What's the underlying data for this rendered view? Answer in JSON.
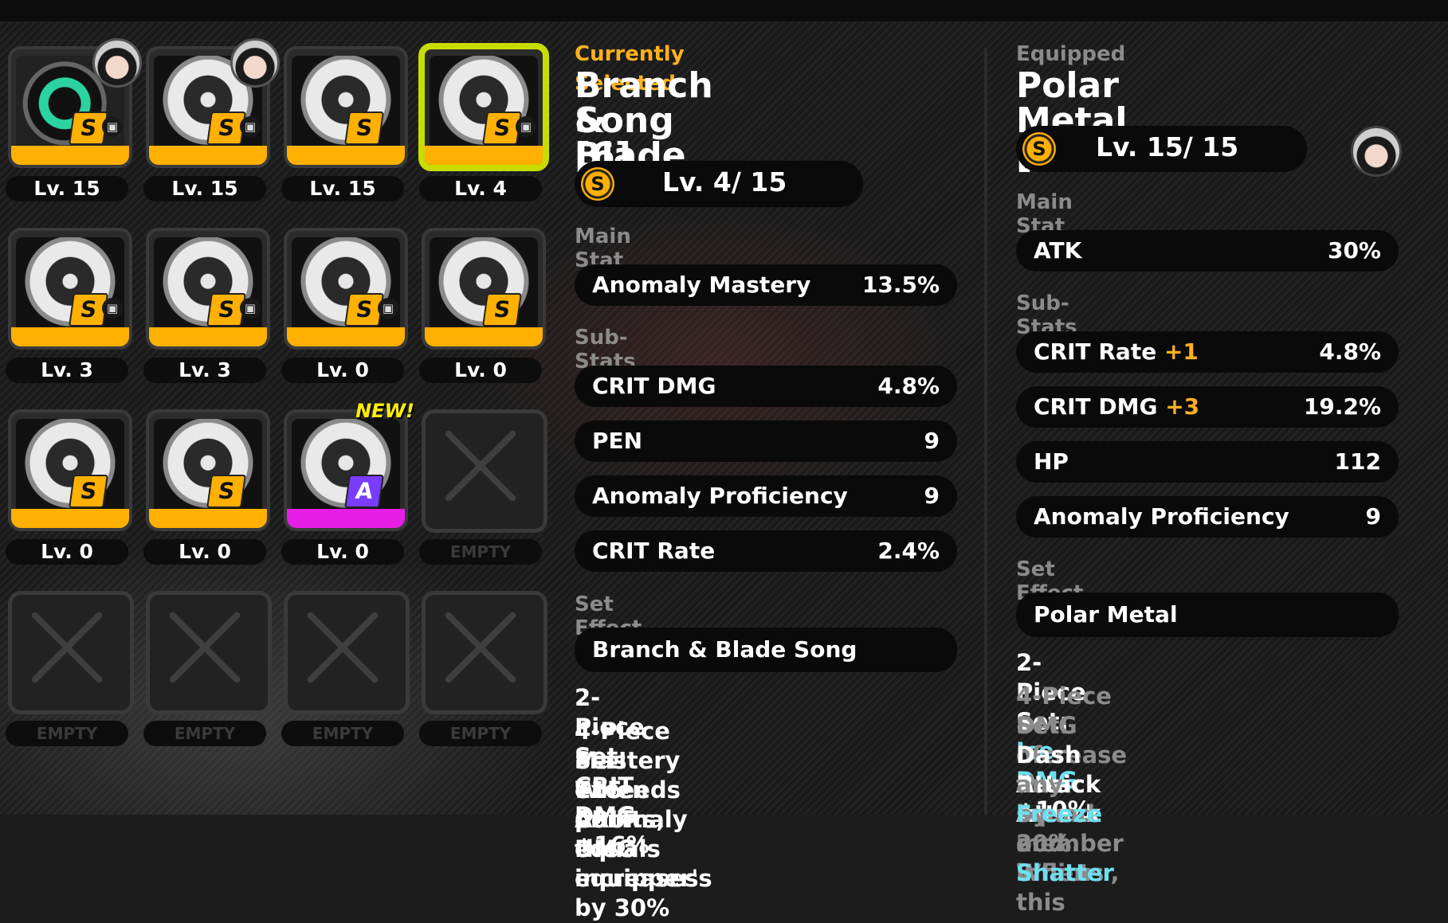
{
  "slots": [
    {
      "level": "Lv. 15",
      "rank": "S",
      "locked": true,
      "avatar": true,
      "variant": "green"
    },
    {
      "level": "Lv. 15",
      "rank": "S",
      "locked": true,
      "avatar": true
    },
    {
      "level": "Lv. 15",
      "rank": "S",
      "locked": false
    },
    {
      "level": "Lv. 4",
      "rank": "S",
      "locked": true,
      "selected": true
    },
    {
      "level": "Lv. 3",
      "rank": "S",
      "locked": true
    },
    {
      "level": "Lv. 3",
      "rank": "S",
      "locked": true
    },
    {
      "level": "Lv. 0",
      "rank": "S",
      "locked": true
    },
    {
      "level": "Lv. 0",
      "rank": "S",
      "locked": false
    },
    {
      "level": "Lv. 0",
      "rank": "S",
      "locked": false
    },
    {
      "level": "Lv. 0",
      "rank": "S",
      "locked": false
    },
    {
      "level": "Lv. 0",
      "rank": "A",
      "locked": false,
      "new": true
    },
    {
      "empty_label": "EMPTY"
    },
    {
      "empty_label": "EMPTY"
    },
    {
      "empty_label": "EMPTY"
    },
    {
      "empty_label": "EMPTY"
    },
    {
      "empty_label": "EMPTY"
    }
  ],
  "new_badge": "NEW!",
  "selected": {
    "header": "Currently Selected",
    "name_line1": "Branch & Blade",
    "name_line2": "Song [6]",
    "rank": "S",
    "level": "Lv. 4/ 15",
    "main_stat_label": "Main Stat",
    "main_stat": {
      "name": "Anomaly Mastery",
      "value": "13.5%"
    },
    "sub_stats_label": "Sub-Stats",
    "sub_stats": [
      {
        "name": "CRIT DMG",
        "value": "4.8%"
      },
      {
        "name": "PEN",
        "value": "9"
      },
      {
        "name": "Anomaly Proficiency",
        "value": "9"
      },
      {
        "name": "CRIT Rate",
        "value": "2.4%"
      }
    ],
    "set_effect_label": "Set Effect",
    "set_name": "Branch & Blade Song",
    "two_piece": "2-Piece Set: CRIT DMG +16%",
    "four_piece_l1": "4-Piece Set: When Anomaly",
    "four_piece_l2": "Mastery exceeds or equals",
    "four_piece_l3": "115 points, the equipper's",
    "four_piece_l4": "CRIT DMG increases by 30%"
  },
  "equipped": {
    "header": "Equipped",
    "name": "Polar Metal [6]",
    "rank": "S",
    "level": "Lv. 15/ 15",
    "main_stat_label": "Main Stat",
    "main_stat": {
      "name": "ATK",
      "value": "30%"
    },
    "sub_stats_label": "Sub-Stats",
    "sub_stats": [
      {
        "name": "CRIT Rate",
        "bonus": "+1",
        "value": "4.8%"
      },
      {
        "name": "CRIT DMG",
        "bonus": "+3",
        "value": "19.2%"
      },
      {
        "name": "HP",
        "bonus": "",
        "value": "112"
      },
      {
        "name": "Anomaly Proficiency",
        "bonus": "",
        "value": "9"
      }
    ],
    "set_effect_label": "Set Effect",
    "set_name": "Polar Metal",
    "two_piece_prefix": "2-Piece Set: ",
    "two_piece_hl": "Ice DMG",
    "two_piece_suffix": " +10%",
    "four_l1": "4-Piece Set: Increase the",
    "four_l2a": "DMG of ",
    "four_l2b": "Basic Attack",
    "four_l2c": " and",
    "four_l3a": "Dash Attack",
    "four_l3b": " by 20%. When",
    "four_l4": "any squad member inflicts",
    "four_l5a": "Freeze",
    "four_l5b": " or ",
    "four_l5c": "Shatter",
    "four_l5d": ", this"
  }
}
